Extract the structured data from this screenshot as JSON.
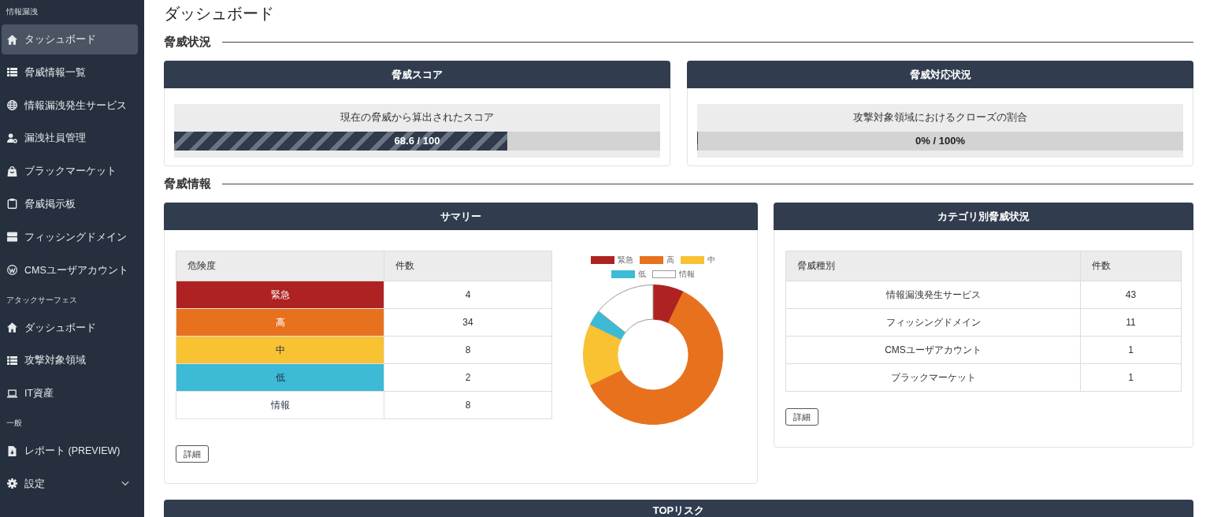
{
  "sidebar": {
    "sections": [
      {
        "label": "情報漏洩",
        "items": [
          {
            "label": "タッシュボード",
            "selected": true
          },
          {
            "label": "脅威情報一覧",
            "selected": false
          },
          {
            "label": "情報漏洩発生サービス",
            "selected": false
          },
          {
            "label": "漏洩社員管理",
            "selected": false
          },
          {
            "label": "ブラックマーケット",
            "selected": false
          },
          {
            "label": "脅威掲示板",
            "selected": false
          },
          {
            "label": "フィッシングドメイン",
            "selected": false
          },
          {
            "label": "CMSユーザアカウント",
            "selected": false
          }
        ]
      },
      {
        "label": "アタックサーフェス",
        "items": [
          {
            "label": "ダッシュボード",
            "selected": false
          },
          {
            "label": "攻撃対象領域",
            "selected": false
          },
          {
            "label": "IT資産",
            "selected": false
          }
        ]
      },
      {
        "label": "一般",
        "items": [
          {
            "label": "レポート (PREVIEW)",
            "selected": false
          },
          {
            "label": "設定",
            "selected": false,
            "expanded": false
          }
        ]
      }
    ]
  },
  "page_title": "ダッシュボード",
  "sections": [
    {
      "heading": "脅威状況",
      "cards": [
        {
          "kind": "meter",
          "title": "脅威スコア",
          "caption": "現在の脅威から算出されたスコア",
          "reading": "68.6 / 100",
          "level": 0.686
        },
        {
          "kind": "meter",
          "title": "脅威対応状況",
          "caption": "攻撃対象領域におけるクローズの割合",
          "reading": "0% / 100%",
          "level": 0
        }
      ]
    },
    {
      "heading": "脅威情報",
      "cards": [
        {
          "kind": "summary",
          "title": "サマリー",
          "table": {
            "columns": [
              "危険度",
              "件数"
            ],
            "rows": [
              {
                "label": "緊急",
                "count": "4",
                "color": "#ae2222"
              },
              {
                "label": "高",
                "count": "34",
                "color": "#e8711e"
              },
              {
                "label": "中",
                "count": "8",
                "color": "#f8c233"
              },
              {
                "label": "低",
                "count": "2",
                "color": "#3dbad5"
              },
              {
                "label": "情報",
                "count": "8",
                "color": "#ffffff"
              }
            ]
          },
          "chart_data": {
            "type": "donut",
            "categories": [
              "緊急",
              "高",
              "中",
              "低",
              "情報"
            ],
            "values": [
              7.14,
              60.71,
              14.29,
              3.57,
              14.29
            ],
            "legend": "top"
          },
          "button": "詳細"
        },
        {
          "kind": "table",
          "title": "カテゴリ別脅威状況",
          "table": {
            "columns": [
              "脅威種別",
              "件数"
            ],
            "rows": [
              {
                "label": "情報漏洩発生サービス",
                "count": "43"
              },
              {
                "label": "フィッシングドメイン",
                "count": "11"
              },
              {
                "label": "CMSユーザアカウント",
                "count": "1"
              },
              {
                "label": "ブラックマーケット",
                "count": "1"
              }
            ]
          },
          "button": "詳細"
        }
      ]
    }
  ],
  "top_risk": {
    "title": "TOPリスク"
  }
}
